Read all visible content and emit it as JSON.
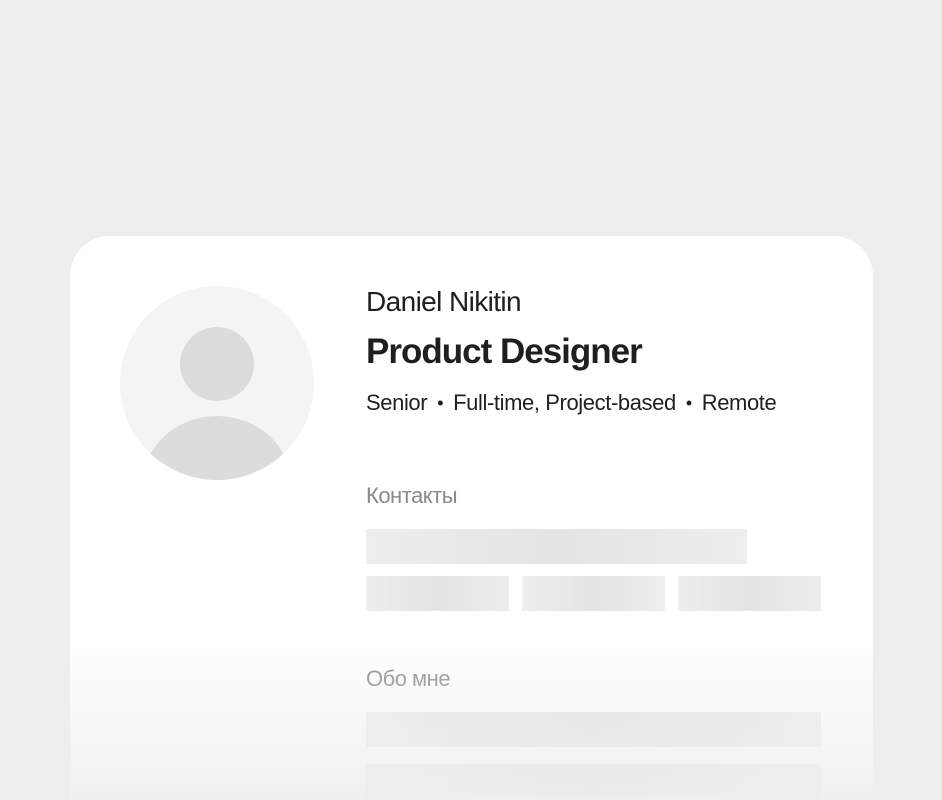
{
  "profile": {
    "name": "Daniel Nikitin",
    "title": "Product Designer",
    "meta": {
      "level": "Senior",
      "employment": "Full-time, Project-based",
      "location": "Remote",
      "separator": "•"
    }
  },
  "sections": {
    "contacts_label": "Контакты",
    "about_label": "Обо мне"
  },
  "colors": {
    "page_background": "#eeeeee",
    "card_background": "#ffffff",
    "text_primary": "#1f1f1f",
    "text_muted": "#8a8a8a",
    "skeleton": "#e8e8e8",
    "avatar_placeholder": "#dcdcdc"
  },
  "icons": {
    "avatar": "user-placeholder-icon"
  }
}
